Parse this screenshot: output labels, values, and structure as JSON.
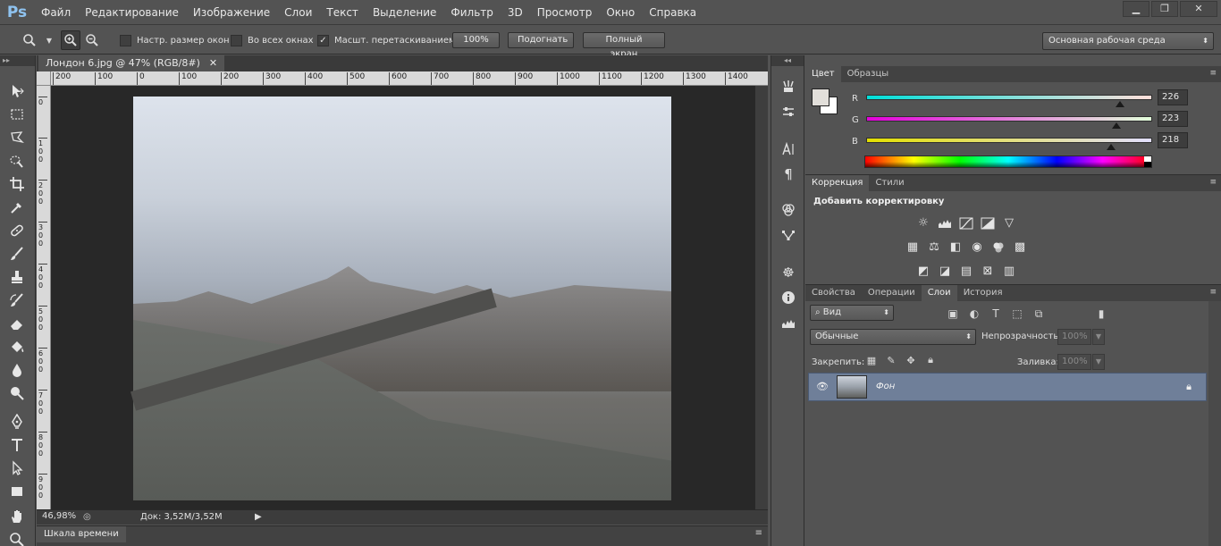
{
  "app": {
    "logo_text": "Ps",
    "menu": [
      "Файл",
      "Редактирование",
      "Изображение",
      "Слои",
      "Текст",
      "Выделение",
      "Фильтр",
      "3D",
      "Просмотр",
      "Окно",
      "Справка"
    ],
    "window_buttons": {
      "minimize": "▁",
      "restore": "❐",
      "close": "✕"
    }
  },
  "options_bar": {
    "resize_windows": {
      "label": "Настр. размер окон",
      "checked": false
    },
    "all_windows": {
      "label": "Во всех окнах",
      "checked": false
    },
    "scrubby_zoom": {
      "label": "Масшт. перетаскиванием",
      "checked": true
    },
    "btn_100": "100%",
    "btn_fit": "Подогнать",
    "btn_fullscreen": "Полный экран",
    "workspace": "Основная рабочая среда"
  },
  "document": {
    "tab_title": "Лондон 6.jpg @ 47% (RGB/8#)",
    "tab_close": "✕",
    "ruler_top": [
      "200",
      "100",
      "0",
      "100",
      "200",
      "300",
      "400",
      "500",
      "600",
      "700",
      "800",
      "900",
      "1000",
      "1100",
      "1200",
      "1300",
      "1400"
    ],
    "ruler_left": [
      "0",
      "1 0 0",
      "2 0 0",
      "3 0 0",
      "4 0 0",
      "5 0 0",
      "6 0 0",
      "7 0 0",
      "8 0 0",
      "9 0 0"
    ],
    "zoom": "46,98%",
    "doc_info": "Док: 3,52M/3,52M",
    "status_arrow": "▶"
  },
  "timeline": {
    "title": "Шкала времени",
    "menu": "≡"
  },
  "color_panel": {
    "tabs": [
      "Цвет",
      "Образцы"
    ],
    "r_label": "R",
    "g_label": "G",
    "b_label": "B",
    "r": "226",
    "g": "223",
    "b": "218",
    "r_level": 0.886,
    "g_level": 0.875,
    "b_level": 0.855,
    "fg_color": "#e2dfda"
  },
  "adjustments_panel": {
    "tabs": [
      "Коррекция",
      "Стили"
    ],
    "title": "Добавить корректировку"
  },
  "layers_panel": {
    "tabs": [
      "Свойства",
      "Операции",
      "Слои",
      "История"
    ],
    "filter_kind": "Вид",
    "blend_mode": "Обычные",
    "opacity_label": "Непрозрачность:",
    "opacity_value": "100%",
    "lock_label": "Закрепить:",
    "fill_label": "Заливка:",
    "fill_value": "100%",
    "layer_name": "Фон"
  }
}
